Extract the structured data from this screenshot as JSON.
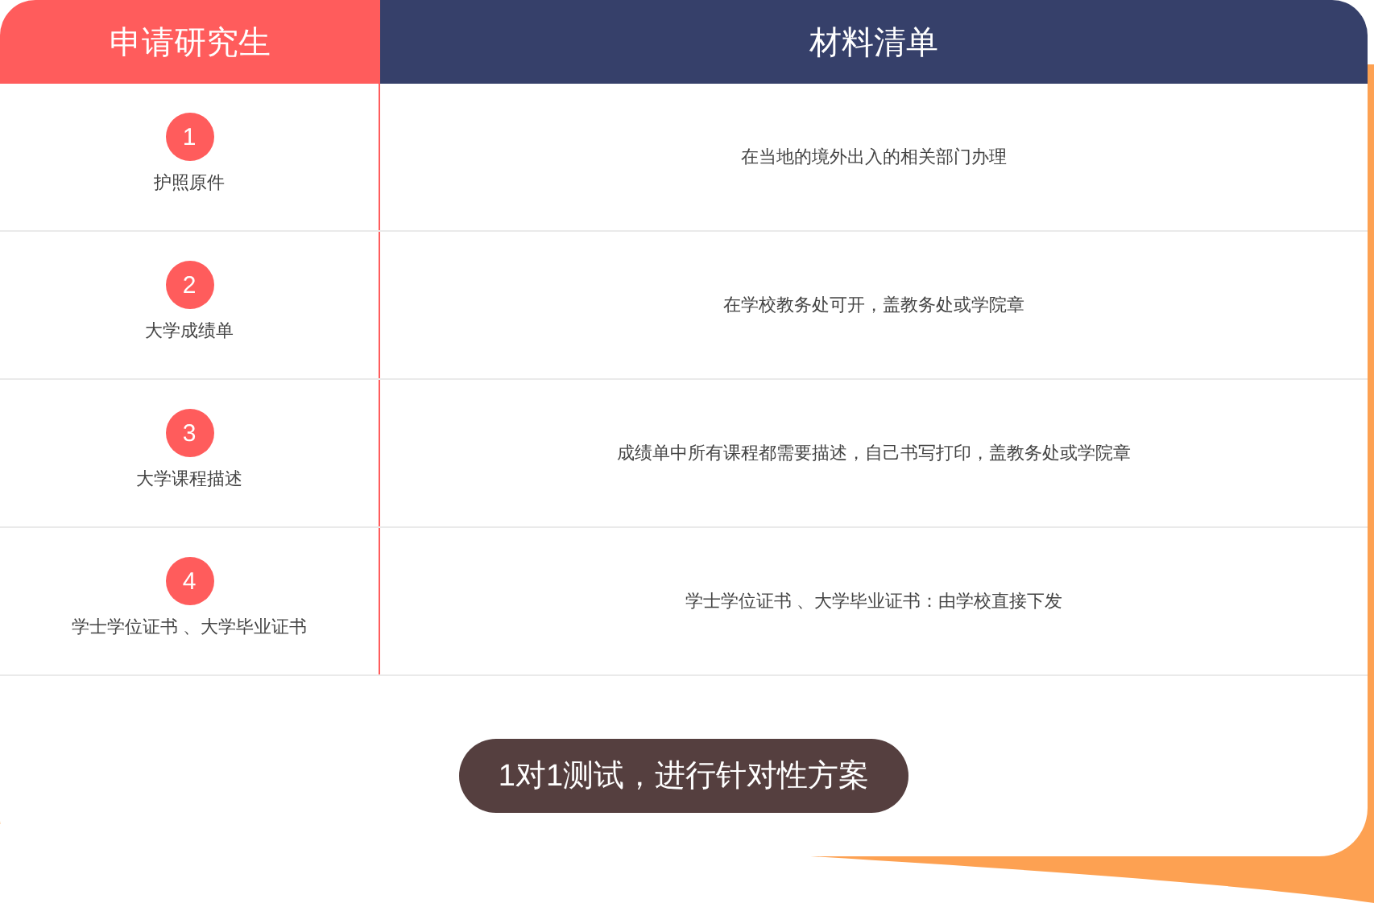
{
  "header": {
    "left_title": "申请研究生",
    "right_title": "材料清单"
  },
  "rows": [
    {
      "number": "1",
      "item": "护照原件",
      "detail": "在当地的境外出入的相关部门办理"
    },
    {
      "number": "2",
      "item": "大学成绩单",
      "detail": "在学校教务处可开，盖教务处或学院章"
    },
    {
      "number": "3",
      "item": "大学课程描述",
      "detail": "成绩单中所有课程都需要描述，自己书写打印，盖教务处或学院章"
    },
    {
      "number": "4",
      "item": "学士学位证书 、大学毕业证书",
      "detail": "学士学位证书 、大学毕业证书：由学校直接下发"
    }
  ],
  "button": {
    "label": "1对1测试，进行针对性方案"
  }
}
